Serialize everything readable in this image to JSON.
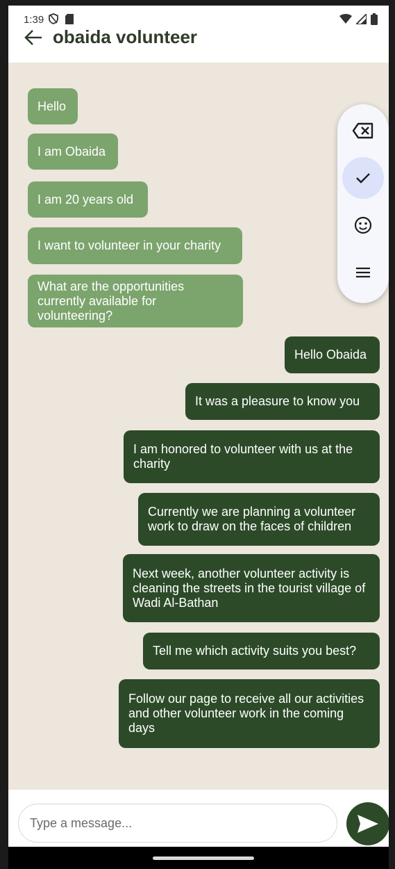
{
  "status_bar": {
    "time": "1:39",
    "left_icons": [
      "shield-icon",
      "sd-card-icon"
    ],
    "right_icons": [
      "wifi-icon",
      "signal-icon",
      "battery-icon"
    ]
  },
  "header": {
    "title": "obaida volunteer",
    "back_icon": "arrow-left-icon"
  },
  "messages": [
    {
      "side": "received",
      "text": "Hello"
    },
    {
      "side": "received",
      "text": "I am Obaida"
    },
    {
      "side": "received",
      "text": "I am 20 years old"
    },
    {
      "side": "received",
      "text": "I want to volunteer in your charity"
    },
    {
      "side": "received",
      "text": "What are the opportunities currently available for volunteering?"
    },
    {
      "side": "sent",
      "text": "Hello Obaida"
    },
    {
      "side": "sent",
      "text": "It was a pleasure to know you"
    },
    {
      "side": "sent",
      "text": "I am honored to volunteer with us at the charity"
    },
    {
      "side": "sent",
      "text": "Currently we are planning a volunteer work to draw on the faces of children"
    },
    {
      "side": "sent",
      "text": "Next week, another volunteer activity is cleaning the streets in the tourist village of Wadi Al-Bathan"
    },
    {
      "side": "sent",
      "text": "Tell me which activity suits you best?"
    },
    {
      "side": "sent",
      "text": "Follow our page to receive all our activities and other volunteer work in the coming days"
    }
  ],
  "keyboard_toolbar": {
    "buttons": [
      "backspace-icon",
      "check-icon",
      "emoji-icon",
      "menu-icon"
    ],
    "active": "check-icon"
  },
  "composer": {
    "placeholder": "Type a message...",
    "value": "",
    "send_icon": "send-icon"
  },
  "colors": {
    "received_bubble": "#7ca46d",
    "sent_bubble": "#2c4a28",
    "chat_background": "#ece6dc",
    "accent": "#2c4a28"
  }
}
